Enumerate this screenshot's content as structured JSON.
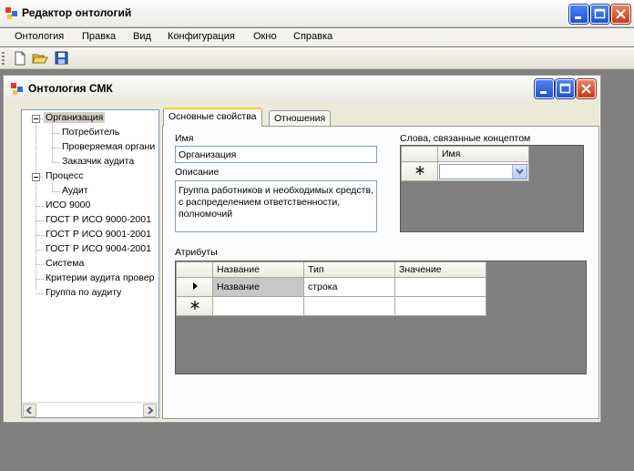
{
  "app": {
    "title": "Редактор онтологий"
  },
  "menu": [
    "Онтология",
    "Правка",
    "Вид",
    "Конфигурация",
    "Окно",
    "Справка"
  ],
  "toolbar": {
    "buttons": [
      "new-file-icon",
      "open-folder-icon",
      "save-disk-icon"
    ]
  },
  "child_window": {
    "title": "Онтология СМК"
  },
  "tree": {
    "items": [
      {
        "label": "Организация",
        "level": 0,
        "expanded": true,
        "selected": true
      },
      {
        "label": "Потребитель",
        "level": 1
      },
      {
        "label": "Проверяемая органи",
        "level": 1
      },
      {
        "label": "Заказчик аудита",
        "level": 1
      },
      {
        "label": "Процесс",
        "level": 0,
        "expanded": true
      },
      {
        "label": "Аудит",
        "level": 1
      },
      {
        "label": "ИСО 9000",
        "level": 0
      },
      {
        "label": "ГОСТ Р ИСО 9000-2001",
        "level": 0
      },
      {
        "label": "ГОСТ Р ИСО 9001-2001",
        "level": 0
      },
      {
        "label": "ГОСТ Р ИСО 9004-2001",
        "level": 0
      },
      {
        "label": "Система",
        "level": 0
      },
      {
        "label": "Критерии аудита провер",
        "level": 0
      },
      {
        "label": "Группа по аудиту",
        "level": 0
      }
    ]
  },
  "tabs": [
    "Основные свойства",
    "Отношения"
  ],
  "form": {
    "name_label": "Имя",
    "name_value": "Организация",
    "description_label": "Описание",
    "description_value": "Группа работников и необходимых средств, с распределением ответственности, полномочий",
    "related_words_label": "Слова, связанные  концептом",
    "related_words_columns": [
      "Имя"
    ],
    "attributes_label": "Атрибуты",
    "attributes_columns": [
      "Название",
      "Тип",
      "Значение"
    ],
    "attributes_rows": [
      {
        "name": "Название",
        "type": "строка",
        "value": ""
      }
    ]
  },
  "colors": {
    "mdi_background": "#808080",
    "window_face": "#ece9d8",
    "tab_highlight": "#ffc83c",
    "close_button": "#c53a12"
  }
}
